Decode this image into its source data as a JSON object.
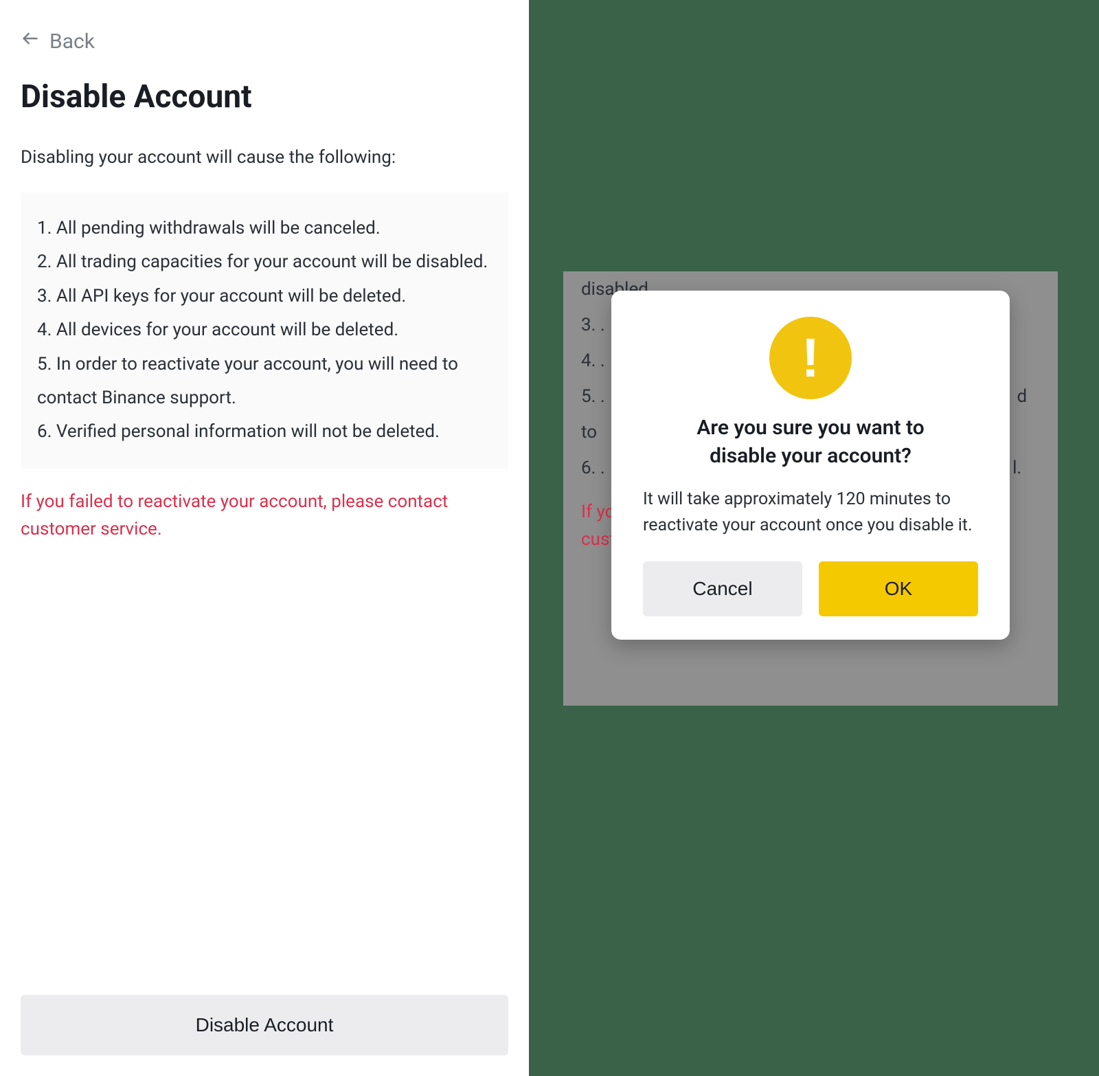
{
  "left": {
    "back_label": "Back",
    "title": "Disable Account",
    "intro": "Disabling your account will cause the following:",
    "items": [
      "1. All pending withdrawals will be canceled.",
      "2. All trading capacities for your account will be disabled.",
      "3. All API keys for your account will be deleted.",
      "4. All devices for your account will be deleted.",
      "5. In order to reactivate your account, you will need to contact Binance support.",
      "6. Verified personal information will not be deleted."
    ],
    "warning": "If you failed to reactivate your account, please contact customer service.",
    "disable_button": "Disable Account"
  },
  "right_bg": {
    "rows": [
      "disabled.",
      "3. .",
      "4. .",
      "5. .                                                                                             d",
      "to",
      "6. .                                                                                            l."
    ],
    "warning_l1": "If you                                                                                                         ct",
    "warning_l2": "custo"
  },
  "modal": {
    "title_l1": "Are you sure you want to",
    "title_l2": "disable your account?",
    "body": "It will take approximately 120 minutes to reactivate your account once you disable it.",
    "cancel": "Cancel",
    "ok": "OK"
  }
}
